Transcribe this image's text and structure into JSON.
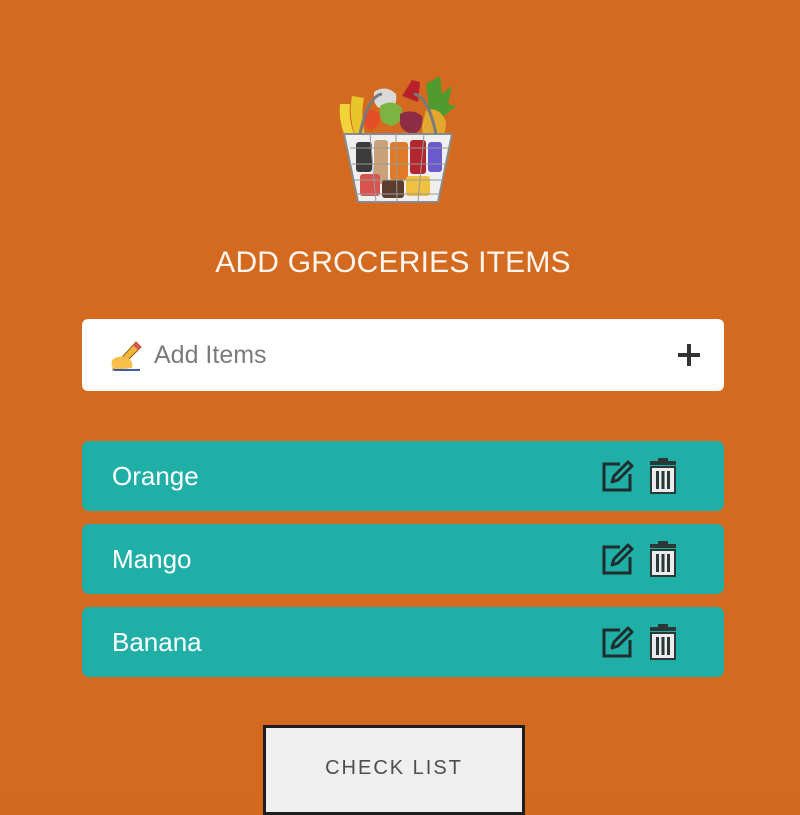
{
  "brand": {
    "background_color": "#d46a1f",
    "item_color": "#20afa7",
    "logo_icon": "grocery-basket-icon"
  },
  "header": {
    "title": "ADD GROCERIES ITEMS"
  },
  "add_form": {
    "input": {
      "value": "",
      "placeholder": "Add Items",
      "icon": "writing-hand-icon"
    },
    "add_button_icon": "plus-icon"
  },
  "items": [
    {
      "label": "Orange",
      "edit_icon": "edit-icon",
      "delete_icon": "trash-icon"
    },
    {
      "label": "Mango",
      "edit_icon": "edit-icon",
      "delete_icon": "trash-icon"
    },
    {
      "label": "Banana",
      "edit_icon": "edit-icon",
      "delete_icon": "trash-icon"
    }
  ],
  "footer": {
    "check_list_label": "CHECK LIST"
  }
}
